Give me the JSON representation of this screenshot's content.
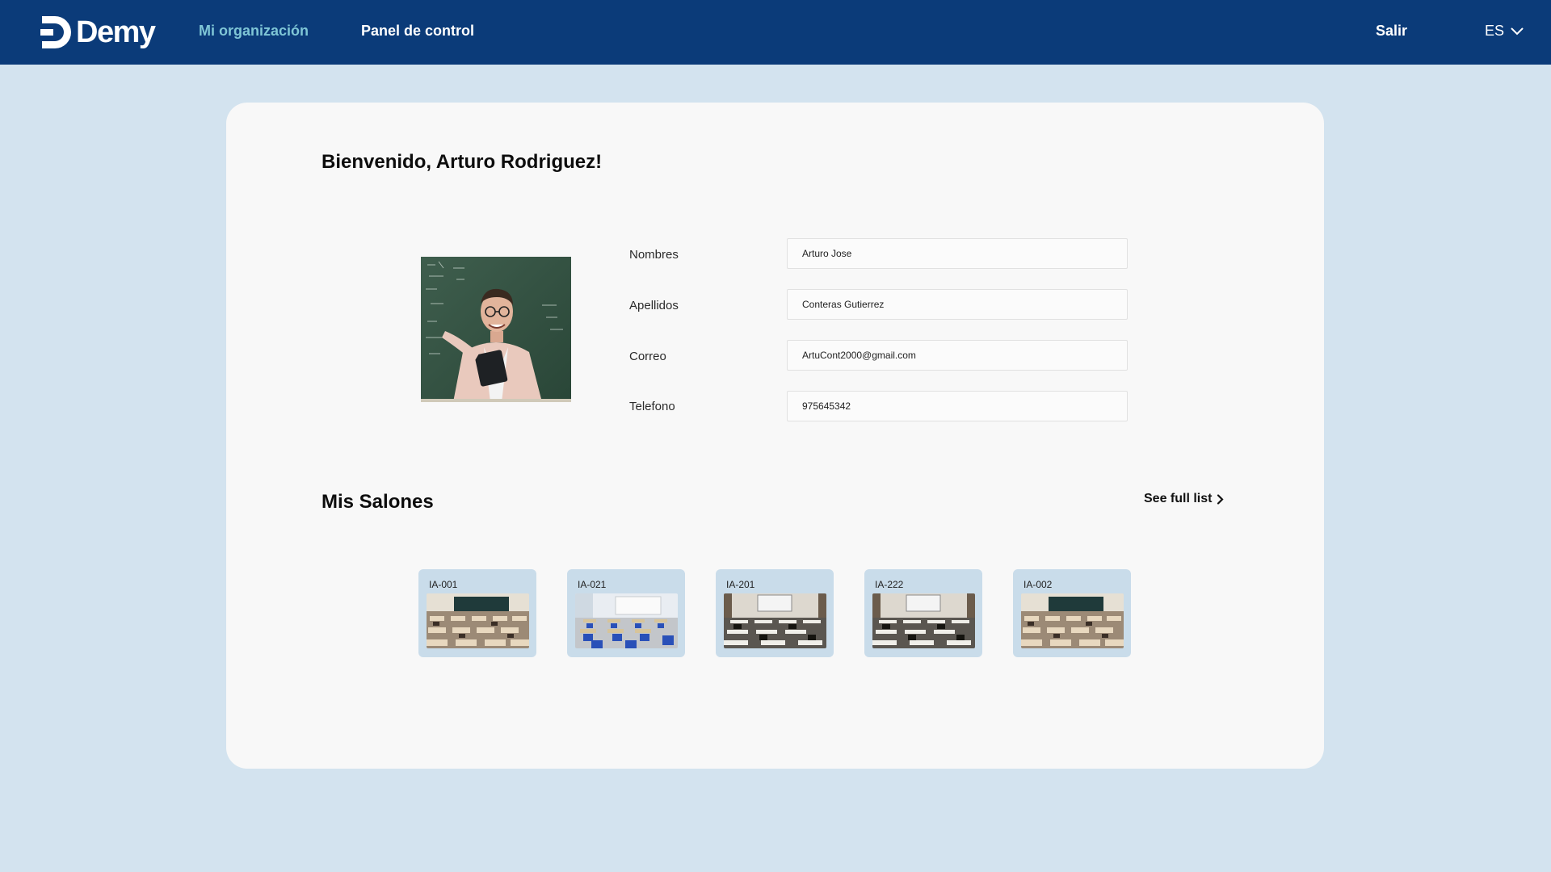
{
  "header": {
    "brand": "Demy",
    "nav": {
      "org": "Mi organización",
      "panel": "Panel de control"
    },
    "logout": "Salir",
    "language": "ES",
    "colors": {
      "bar": "#0b3b79",
      "active_link": "#7fc6d6"
    }
  },
  "profile": {
    "welcome": "Bienvenido, Arturo Rodriguez!",
    "photo_icon": "teacher-photo",
    "fields": [
      {
        "label": "Nombres",
        "value": "Arturo Jose"
      },
      {
        "label": "Apellidos",
        "value": "Conteras Gutierrez"
      },
      {
        "label": "Correo",
        "value": "ArtuCont2000@gmail.com"
      },
      {
        "label": "Telefono",
        "value": "975645342"
      }
    ]
  },
  "classrooms": {
    "title": "Mis Salones",
    "see_full": "See full list",
    "items": [
      {
        "code": "IA-001",
        "image": "classroom-wood-desks"
      },
      {
        "code": "IA-021",
        "image": "classroom-blue-chairs"
      },
      {
        "code": "IA-201",
        "image": "classroom-dark-lecture"
      },
      {
        "code": "IA-222",
        "image": "classroom-dark-lecture"
      },
      {
        "code": "IA-002",
        "image": "classroom-wood-desks"
      }
    ]
  }
}
